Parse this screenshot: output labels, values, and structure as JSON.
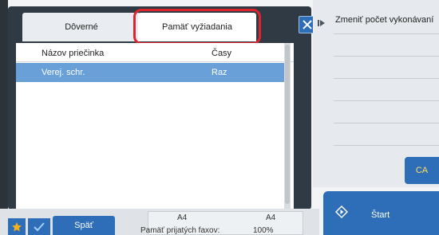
{
  "tabs": {
    "confidential_label": "Dôverné",
    "retention_label": "Pamäť vyžiadania"
  },
  "list": {
    "header_name": "Názov priečinka",
    "header_times": "Časy",
    "rows": [
      {
        "name": "Verej. schr.",
        "times": "Raz",
        "selected": true
      }
    ]
  },
  "right_panel": {
    "title": "Zmeniť počet vykonávaní",
    "ca_label": "CA"
  },
  "start_label": "Štart",
  "bottom": {
    "back_label": "Späť",
    "paper_left": "A4",
    "paper_right": "A4",
    "fax_memory_label": "Pamäť prijatých faxov:",
    "fax_memory_value": "100%"
  },
  "colors": {
    "accent": "#2e6db8",
    "highlight": "#e0242d",
    "selected_row": "#6aa0d8",
    "ca_text": "#ffe15c"
  },
  "icons": [
    "close-icon",
    "collapse-arrow-icon",
    "star-icon",
    "check-icon",
    "start-icon"
  ]
}
